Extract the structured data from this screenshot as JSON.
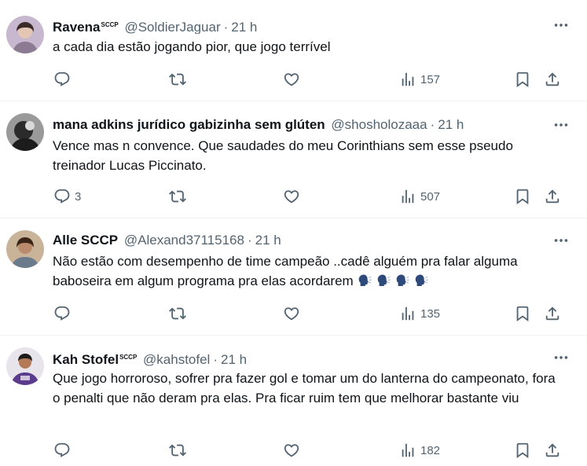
{
  "tweets": [
    {
      "name": "Ravena",
      "badge": "SCCP",
      "handle": "@SoldierJaguar",
      "time": "21 h",
      "text": "a cada dia estão jogando pior, que jogo terrível",
      "replies": "",
      "views": "157"
    },
    {
      "name": "mana adkins jurídico gabizinha sem glúten",
      "badge": "",
      "handle": "@shosholozaaa",
      "time": "21 h",
      "text": "Vence mas n convence. Que saudades do meu Corinthians sem esse pseudo treinador Lucas Piccinato.",
      "replies": "3",
      "views": "507"
    },
    {
      "name": "Alle SCCP",
      "badge": "",
      "handle": "@Alexand37115168",
      "time": "21 h",
      "text": "Não estão com desempenho de time campeão ..cadê alguém pra falar alguma baboseira em algum programa pra elas acordarem",
      "emoji": "speaking-head-emoji ×4",
      "replies": "",
      "views": "135"
    },
    {
      "name": "Kah Stofel",
      "badge": "SCCP",
      "handle": "@kahstofel",
      "time": "21 h",
      "text": "Que jogo horroroso, sofrer pra fazer gol e tomar um do lanterna do campeonato, fora o penalti que não deram pra elas. Pra ficar ruim tem que melhorar bastante viu",
      "replies": "",
      "views": "182"
    }
  ],
  "dot": "·",
  "colors": {
    "text": "#0f1419",
    "secondary": "#536471",
    "divider": "#eff3f4",
    "background": "#ffffff"
  },
  "icons": [
    "reply-icon",
    "retweet-icon",
    "like-icon",
    "views-icon",
    "bookmark-icon",
    "share-icon",
    "more-icon"
  ]
}
